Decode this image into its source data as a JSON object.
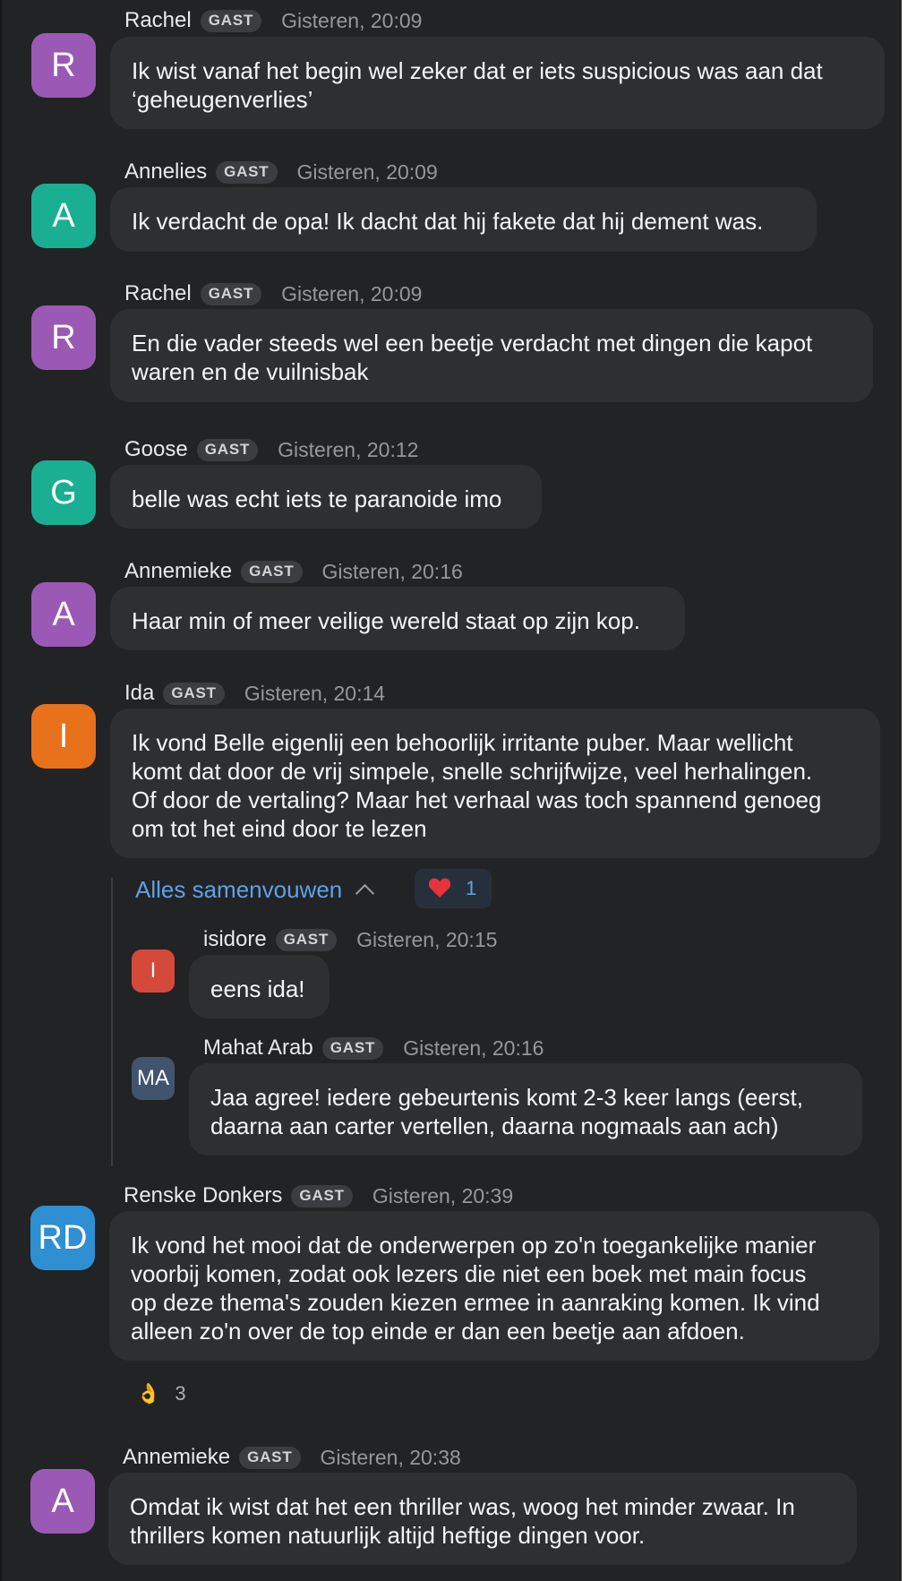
{
  "colors": {
    "background": "#222324",
    "bubble": "#2e2f31",
    "link": "#5ea1e8",
    "avatar_purple": "#9b59b6",
    "avatar_teal": "#1aaf93",
    "avatar_orange": "#e8711b",
    "avatar_red": "#d5493a",
    "avatar_slate": "#41546e",
    "avatar_blue": "#2e8fd2"
  },
  "messages": [
    {
      "name": "Rachel",
      "badge": "GAST",
      "time": "Gisteren, 20:09",
      "initials": "R",
      "lines": [
        "Ik wist vanaf het begin wel zeker dat er iets suspicious was aan dat",
        "‘geheugenverlies’"
      ]
    },
    {
      "name": "Annelies",
      "badge": "GAST",
      "time": "Gisteren, 20:09",
      "initials": "A",
      "lines": [
        "Ik verdacht de opa! Ik dacht dat hij fakete dat hij dement was."
      ]
    },
    {
      "name": "Rachel",
      "badge": "GAST",
      "time": "Gisteren, 20:09",
      "initials": "R",
      "lines": [
        "En die vader steeds wel een beetje verdacht met dingen die kapot",
        "waren en de vuilnisbak"
      ]
    },
    {
      "name": "Goose",
      "badge": "GAST",
      "time": "Gisteren, 20:12",
      "initials": "G",
      "lines": [
        "belle was echt iets te paranoide imo"
      ]
    },
    {
      "name": "Annemieke",
      "badge": "GAST",
      "time": "Gisteren, 20:16",
      "initials": "A",
      "lines": [
        "Haar min of meer veilige wereld staat op zijn kop."
      ]
    },
    {
      "name": "Ida",
      "badge": "GAST",
      "time": "Gisteren, 20:14",
      "initials": "I",
      "lines": [
        "Ik vond Belle eigenlij een behoorlijk irritante puber. Maar wellicht",
        "komt dat door de vrij simpele, snelle schrijfwijze, veel herhalingen.",
        "Of door de vertaling? Maar het verhaal was toch spannend genoeg",
        "om tot het eind door te lezen"
      ]
    },
    {
      "name": "isidore",
      "badge": "GAST",
      "time": "Gisteren, 20:15",
      "initials": "I",
      "lines": [
        "eens ida!"
      ]
    },
    {
      "name": "Mahat Arab",
      "badge": "GAST",
      "time": "Gisteren, 20:16",
      "initials": "MA",
      "lines": [
        "Jaa agree! iedere gebeurtenis komt 2-3 keer langs (eerst,",
        "daarna aan carter vertellen, daarna nogmaals aan ach)"
      ]
    },
    {
      "name": "Renske Donkers",
      "badge": "GAST",
      "time": "Gisteren, 20:39",
      "initials": "RD",
      "lines": [
        "Ik vond het mooi dat de onderwerpen op zo'n toegankelijke manier",
        "voorbij komen, zodat ook lezers die niet een boek met main focus",
        "op deze thema's zouden kiezen ermee in aanraking komen. Ik vind",
        "alleen zo'n over de top einde er dan een beetje aan afdoen."
      ]
    },
    {
      "name": "Annemieke",
      "badge": "GAST",
      "time": "Gisteren, 20:38",
      "initials": "A",
      "lines": [
        "Omdat ik wist dat het een thriller was, woog het minder zwaar. In",
        "thrillers komen natuurlijk altijd heftige dingen voor."
      ]
    }
  ],
  "thread": {
    "collapse_label": "Alles samenvouwen",
    "heart_reaction": {
      "emoji": "❤️",
      "count": "1",
      "icon": "heart-icon"
    },
    "chevron_icon": "chevron-up-icon"
  },
  "renske_reaction": {
    "emoji": "👌",
    "count": "3",
    "icon": "ok-hand-icon"
  }
}
